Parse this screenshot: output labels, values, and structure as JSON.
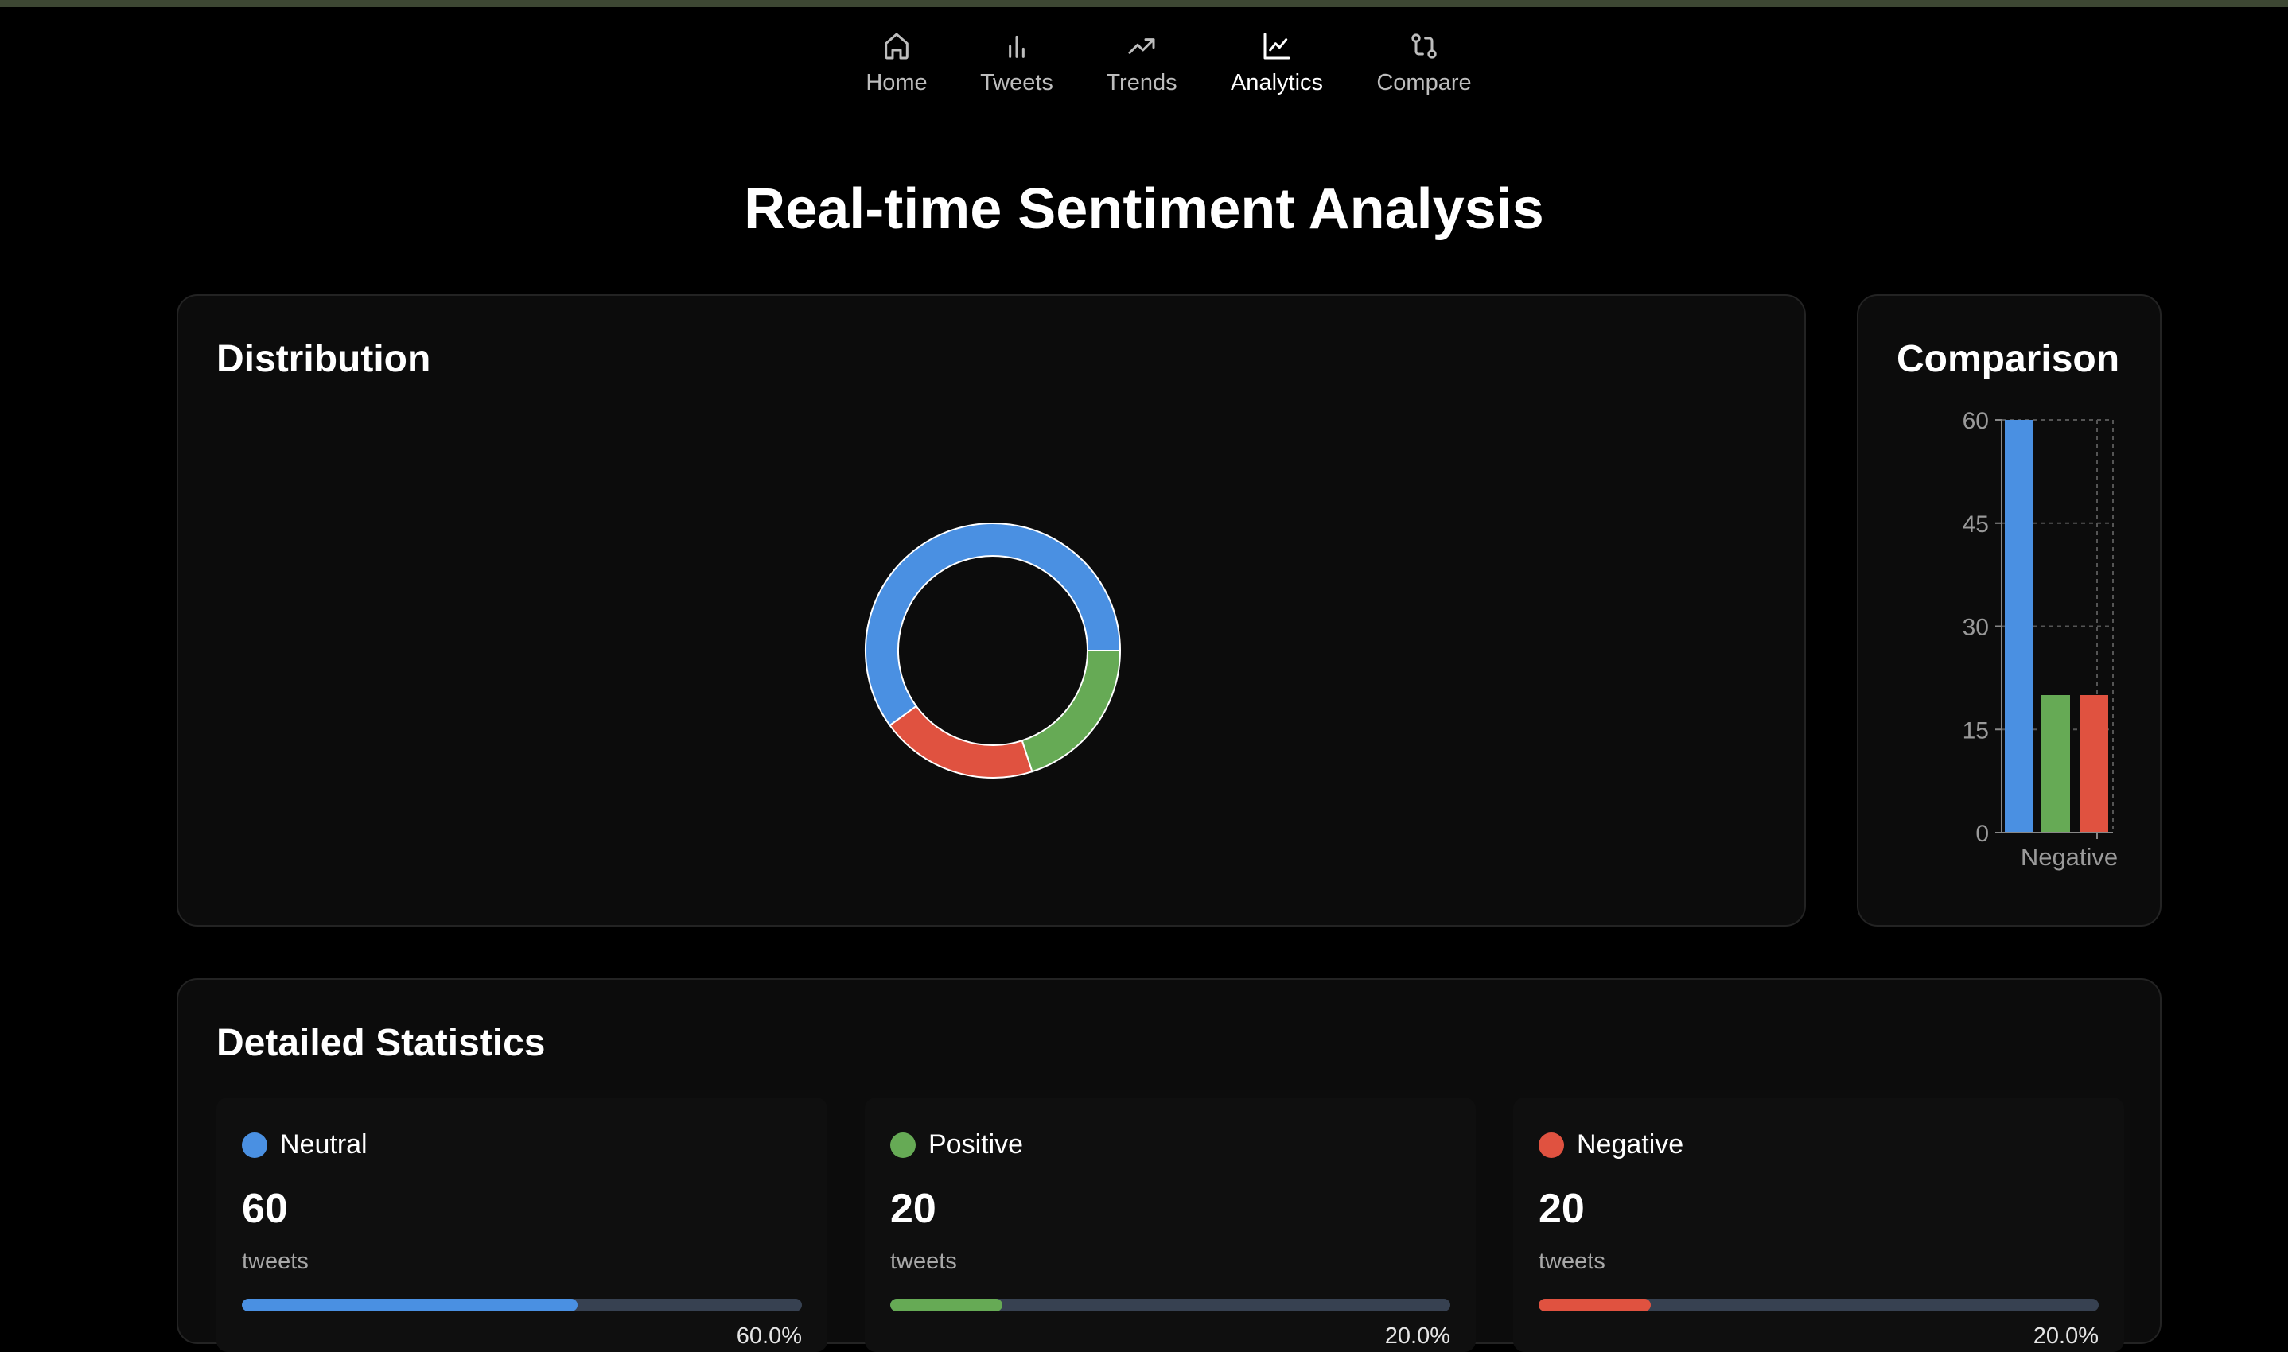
{
  "nav": {
    "items": [
      {
        "label": "Home",
        "icon": "home-icon"
      },
      {
        "label": "Tweets",
        "icon": "bar-chart-icon"
      },
      {
        "label": "Trends",
        "icon": "trending-up-icon"
      },
      {
        "label": "Analytics",
        "icon": "line-chart-icon",
        "active": true
      },
      {
        "label": "Compare",
        "icon": "git-compare-icon"
      }
    ]
  },
  "page": {
    "title": "Real-time Sentiment Analysis"
  },
  "distribution": {
    "title": "Distribution"
  },
  "comparison": {
    "title": "Comparison"
  },
  "stats": {
    "title": "Detailed Statistics",
    "items": [
      {
        "name": "Neutral",
        "count": "60",
        "unit": "tweets",
        "percent": "60.0%",
        "fraction": 0.6,
        "color": "#4a90e2"
      },
      {
        "name": "Positive",
        "count": "20",
        "unit": "tweets",
        "percent": "20.0%",
        "fraction": 0.2,
        "color": "#66aa55"
      },
      {
        "name": "Negative",
        "count": "20",
        "unit": "tweets",
        "percent": "20.0%",
        "fraction": 0.2,
        "color": "#e05240"
      }
    ]
  },
  "colors": {
    "neutral": "#4a90e2",
    "positive": "#66aa55",
    "negative": "#e05240",
    "card_bg": "#0c0c0c",
    "page_bg": "#000000"
  },
  "chart_data": [
    {
      "type": "pie",
      "title": "Distribution",
      "categories": [
        "Neutral",
        "Negative",
        "Positive"
      ],
      "values": [
        60,
        20,
        20
      ],
      "colors": [
        "#4a90e2",
        "#e05240",
        "#66aa55"
      ],
      "donut": true
    },
    {
      "type": "bar",
      "title": "Comparison",
      "categories": [
        "Neutral",
        "Positive",
        "Negative"
      ],
      "visible_x_tick_labels": [
        "Negative"
      ],
      "values": [
        60,
        20,
        20
      ],
      "colors": [
        "#4a90e2",
        "#66aa55",
        "#e05240"
      ],
      "ylim": [
        0,
        60
      ],
      "yticks": [
        0,
        15,
        30,
        45,
        60
      ],
      "grid": true
    }
  ]
}
